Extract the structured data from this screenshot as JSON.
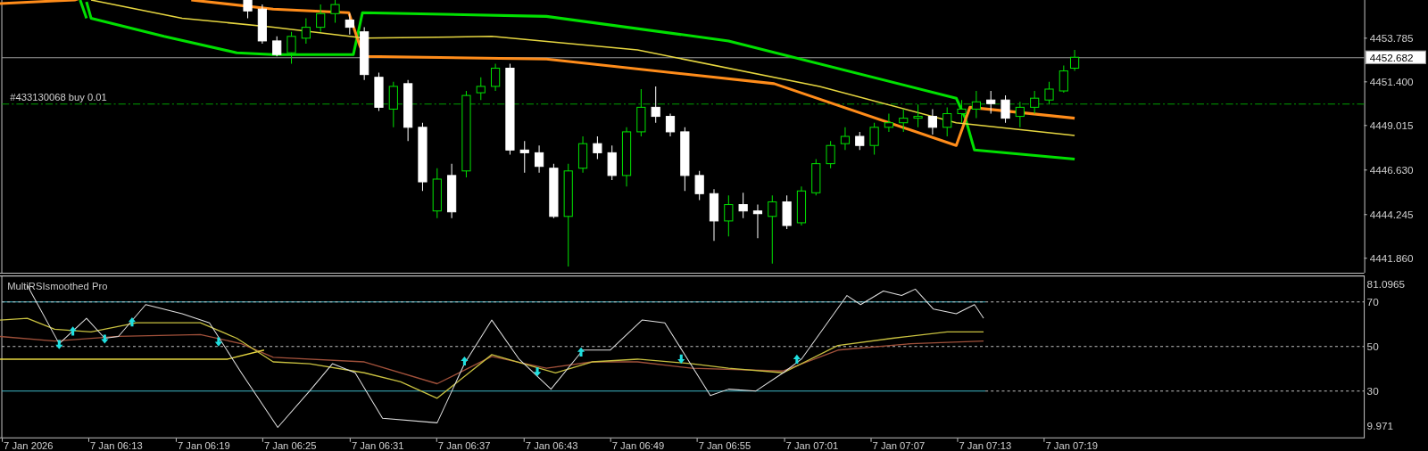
{
  "trade_line": {
    "label": "#433130068 buy 0.01"
  },
  "price_axis": [
    {
      "label": "4453.785",
      "kind": "tick"
    },
    {
      "label": "4452.682",
      "kind": "current"
    },
    {
      "label": "4451.400",
      "kind": "tick"
    },
    {
      "label": "4449.015",
      "kind": "tick"
    },
    {
      "label": "4446.630",
      "kind": "tick"
    },
    {
      "label": "4444.245",
      "kind": "tick"
    },
    {
      "label": "4441.860",
      "kind": "tick"
    }
  ],
  "indicator": {
    "title": "MultiRSIsmoothed Pro",
    "axis": [
      "81.0965",
      "70",
      "50",
      "30",
      "9.971"
    ]
  },
  "time_axis": [
    "7 Jan 2026",
    "7 Jan 06:13",
    "7 Jan 06:19",
    "7 Jan 06:25",
    "7 Jan 06:31",
    "7 Jan 06:37",
    "7 Jan 06:43",
    "7 Jan 06:49",
    "7 Jan 06:55",
    "7 Jan 07:01",
    "7 Jan 07:07",
    "7 Jan 07:13",
    "7 Jan 07:19"
  ]
}
